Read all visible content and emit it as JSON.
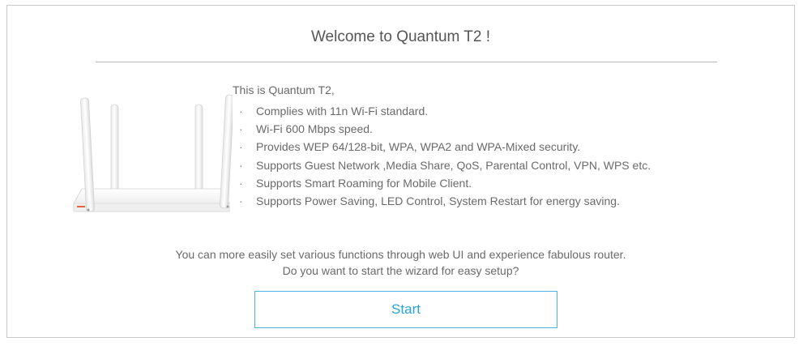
{
  "welcome": {
    "title": "Welcome to Quantum T2 !",
    "intro": "This is Quantum T2,",
    "bullet_glyph": "·",
    "features": [
      "Complies with 11n Wi-Fi standard.",
      "Wi-Fi 600 Mbps speed.",
      "Provides WEP 64/128-bit, WPA, WPA2 and WPA-Mixed security.",
      "Supports Guest Network ,Media Share, QoS, Parental Control, VPN, WPS etc.",
      "Supports Smart Roaming for Mobile Client.",
      "Supports Power Saving, LED Control, System Restart for energy saving."
    ],
    "description_line1": "You can more easily set various functions through web UI and experience fabulous router.",
    "description_line2": "Do you want to start the wizard for easy setup?",
    "start_label": "Start"
  },
  "colors": {
    "accent": "#2aa3dc",
    "border": "#c9c9c9",
    "text": "#6a6a6a"
  },
  "icons": {
    "product_image": "router-icon"
  }
}
